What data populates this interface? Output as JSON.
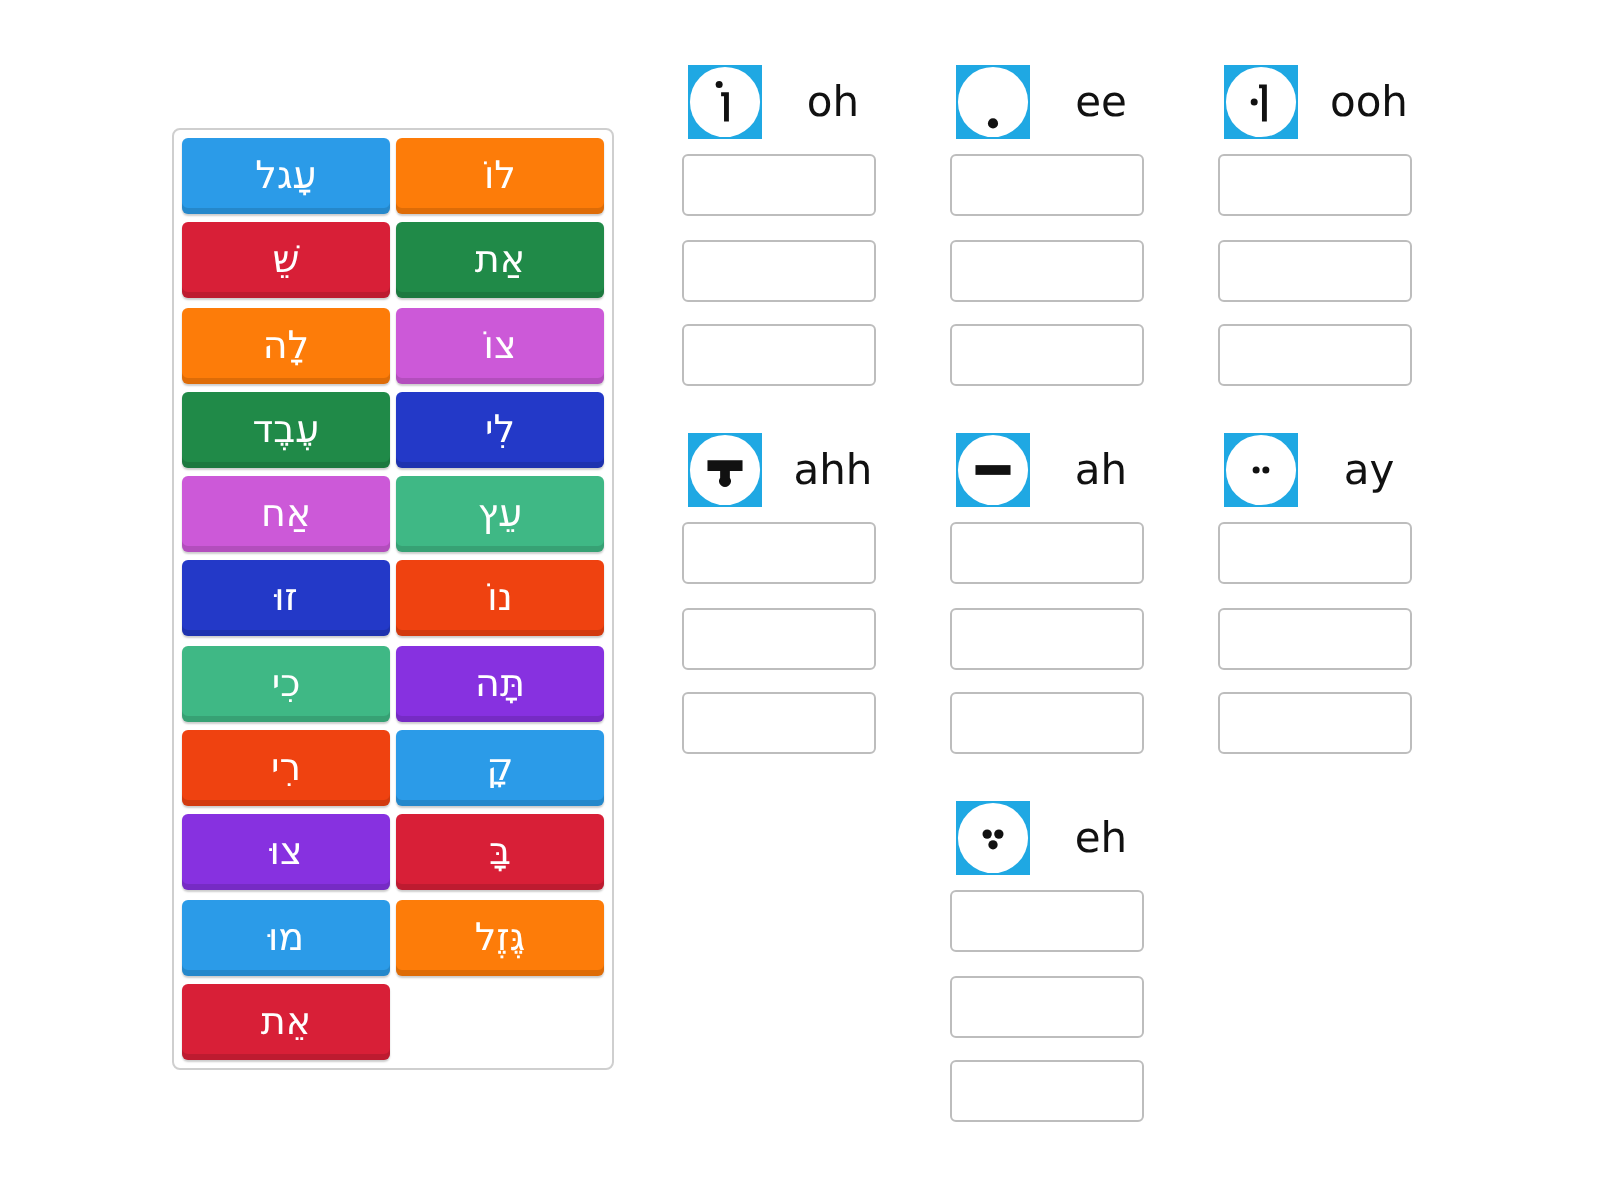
{
  "tiles": [
    {
      "text": "לוֹ",
      "color": "#fd7c09"
    },
    {
      "text": "עָגל",
      "color": "#2b9be8"
    },
    {
      "text": "אַת",
      "color": "#208a48"
    },
    {
      "text": "שֵׁ",
      "color": "#d81f37"
    },
    {
      "text": "צוֹ",
      "color": "#cc59d8"
    },
    {
      "text": "לָה",
      "color": "#fd7c09"
    },
    {
      "text": "לִי",
      "color": "#2339c8"
    },
    {
      "text": "עֶבֶד",
      "color": "#208a48"
    },
    {
      "text": "עֵץ",
      "color": "#3fb885"
    },
    {
      "text": "אַח",
      "color": "#cc59d8"
    },
    {
      "text": "נוֹ",
      "color": "#ef4210"
    },
    {
      "text": "זוּ",
      "color": "#2339c8"
    },
    {
      "text": "תָּה",
      "color": "#8731e0"
    },
    {
      "text": "כִי",
      "color": "#3fb885"
    },
    {
      "text": "קָ",
      "color": "#2b9be8"
    },
    {
      "text": "רִי",
      "color": "#ef4210"
    },
    {
      "text": "בָּ",
      "color": "#d81f37"
    },
    {
      "text": "צוּ",
      "color": "#8731e0"
    },
    {
      "text": "גֶּזֶל",
      "color": "#fd7c09"
    },
    {
      "text": "מוּ",
      "color": "#2b9be8"
    },
    {
      "text": "אֵת",
      "color": "#d81f37"
    }
  ],
  "groups": [
    {
      "label": "ooh",
      "kind": "shuruk"
    },
    {
      "label": "ee",
      "kind": "hiriq"
    },
    {
      "label": "oh",
      "kind": "holam"
    },
    {
      "label": "ay",
      "kind": "tsere"
    },
    {
      "label": "ah",
      "kind": "patah"
    },
    {
      "label": "ahh",
      "kind": "qamats"
    },
    {
      "label": "eh",
      "kind": "segol"
    }
  ]
}
